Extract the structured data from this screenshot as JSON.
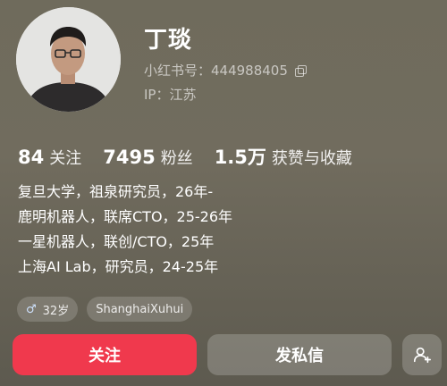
{
  "profile": {
    "name": "丁琰",
    "id_line": "小红书号：444988405",
    "ip_line": "IP：江苏"
  },
  "stats": [
    {
      "value": "84",
      "label": "关注"
    },
    {
      "value": "7495",
      "label": "粉丝"
    },
    {
      "value": "1.5万",
      "label": "获赞与收藏"
    }
  ],
  "bio": [
    "复旦大学，祖泉研究员，26年-",
    "鹿明机器人，联席CTO，25-26年",
    "一星机器人，联创/CTO，25年",
    "上海AI Lab，研究员，24-25年"
  ],
  "tags": [
    {
      "icon": "male-icon",
      "label": "32岁"
    },
    {
      "label": "ShanghaiXuhui"
    }
  ],
  "actions": {
    "follow_label": "关注",
    "message_label": "发私信",
    "add_friend_icon": "add-friend-icon"
  },
  "colors": {
    "follow_button": "#f0394d",
    "background": "#716c5e"
  }
}
